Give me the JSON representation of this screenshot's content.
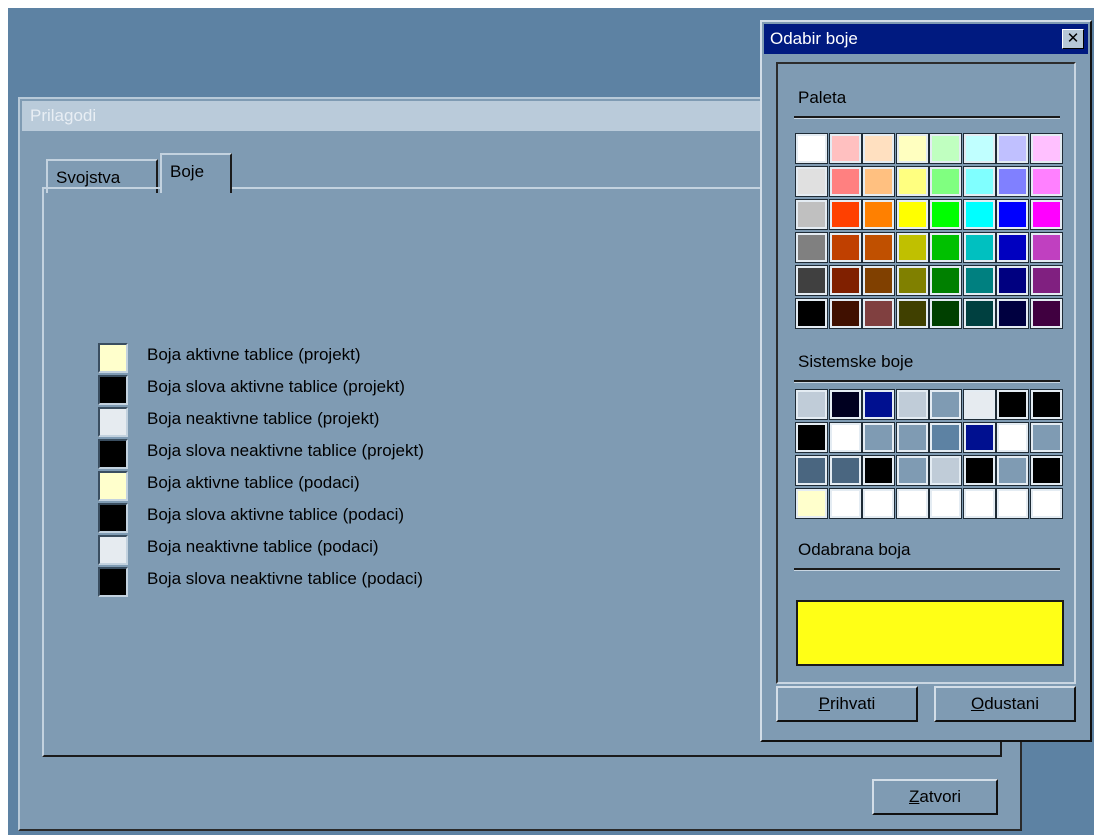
{
  "main_window": {
    "title": "Prilagodi",
    "tabs": [
      "Svojstva",
      "Boje"
    ],
    "color_settings": [
      {
        "label": "Boja aktivne tablice (projekt)",
        "color": "#ffffcc"
      },
      {
        "label": "Boja slova aktivne tablice (projekt)",
        "color": "#000000"
      },
      {
        "label": "Boja neaktivne tablice (projekt)",
        "color": "#e6ebf0"
      },
      {
        "label": "Boja slova neaktivne tablice (projekt)",
        "color": "#000000"
      },
      {
        "label": "Boja aktivne tablice (podaci)",
        "color": "#ffffcc"
      },
      {
        "label": "Boja slova aktivne tablice (podaci)",
        "color": "#000000"
      },
      {
        "label": "Boja neaktivne tablice (podaci)",
        "color": "#e6ebf0"
      },
      {
        "label": "Boja slova neaktivne tablice (podaci)",
        "color": "#000000"
      }
    ],
    "close_button": {
      "accel": "Z",
      "rest": "atvori"
    }
  },
  "picker": {
    "title": "Odabir boje",
    "close_icon": "x-icon",
    "palette_label": "Paleta",
    "palette": [
      [
        "#ffffff",
        "#ffc0c0",
        "#ffe0c0",
        "#ffffc0",
        "#c0ffc0",
        "#c0ffff",
        "#c0c0ff",
        "#ffc0ff"
      ],
      [
        "#e0e0e0",
        "#ff8080",
        "#ffc080",
        "#ffff80",
        "#80ff80",
        "#80ffff",
        "#8080ff",
        "#ff80ff"
      ],
      [
        "#c0c0c0",
        "#ff4000",
        "#ff8000",
        "#ffff00",
        "#00ff00",
        "#00ffff",
        "#0000ff",
        "#ff00ff"
      ],
      [
        "#808080",
        "#c04000",
        "#c05000",
        "#c0c000",
        "#00c000",
        "#00c0c0",
        "#0000c0",
        "#c040c0"
      ],
      [
        "#404040",
        "#802000",
        "#804000",
        "#808000",
        "#008000",
        "#008080",
        "#000080",
        "#802080"
      ],
      [
        "#000000",
        "#401000",
        "#804040",
        "#404000",
        "#004000",
        "#004040",
        "#000040",
        "#400040"
      ]
    ],
    "system_label": "Sistemske boje",
    "system_colors": [
      [
        "#c0ccd8",
        "#000020",
        "#001090",
        "#c0ccd8",
        "#7f9bb3",
        "#e6ebf0",
        "#000000",
        "#000000"
      ],
      [
        "#000000",
        "#ffffff",
        "#7f9bb3",
        "#7f9bb3",
        "#5d82a3",
        "#001090",
        "#ffffff",
        "#7f9bb3"
      ],
      [
        "#4a6680",
        "#4a6680",
        "#000000",
        "#7f9bb3",
        "#c0ccd8",
        "#000000",
        "#7f9bb3",
        "#000000"
      ],
      [
        "#ffffcc",
        "#ffffff",
        "#ffffff",
        "#ffffff",
        "#ffffff",
        "#ffffff",
        "#ffffff",
        "#ffffff"
      ]
    ],
    "selected_label": "Odabrana boja",
    "selected_color": "#ffff16",
    "accept_button": {
      "accel": "P",
      "rest": "rihvati"
    },
    "cancel_button": {
      "accel": "O",
      "rest": "dustani"
    }
  }
}
